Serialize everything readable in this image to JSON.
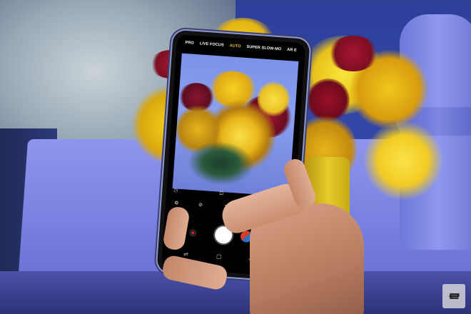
{
  "camera": {
    "modes": [
      "PRO",
      "LIVE FOCUS",
      "AUTO",
      "SUPER SLOW-MO",
      "AR E"
    ],
    "active_mode": "AUTO"
  },
  "icons": {
    "settings": "gear-icon",
    "record": "record-icon",
    "shutter": "shutter-icon",
    "switch_camera": "switch-camera-icon",
    "back": "back-arrow-icon",
    "recent": "recent-apps-icon",
    "home": "home-icon"
  },
  "colors": {
    "active_mode": "#f3c21c",
    "record": "#e01b24",
    "table": "#7b83e2"
  },
  "watermark": {
    "logo": "engadget-e-logo"
  }
}
